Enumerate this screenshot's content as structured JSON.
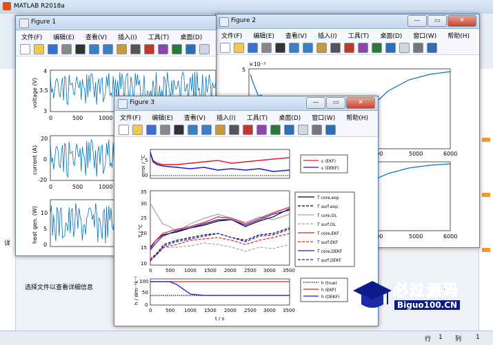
{
  "matlab": {
    "title": "MATLAB R2018a",
    "file_info": "选择文件以查看详细信息",
    "status_row_label": "行",
    "status_row": "1",
    "status_col_label": "列",
    "status_col": "1",
    "side_label": "详"
  },
  "menu": [
    "文件(F)",
    "编辑(E)",
    "查看(V)",
    "插入(I)",
    "工具(T)",
    "桌面(D)",
    "窗口(W)",
    "帮助(H)"
  ],
  "figure1": {
    "title": "Figure 1",
    "ylabels": [
      "voltage (V)",
      "current (A)",
      "heat gen. (W)"
    ],
    "yticks1": [
      "4",
      "3.5",
      "3"
    ],
    "yticks2": [
      "20",
      "0",
      "-20"
    ],
    "yticks3": [
      "10",
      "5",
      "0"
    ],
    "xticks": [
      "0",
      "500",
      "1000"
    ]
  },
  "figure2": {
    "title": "Figure 2",
    "exponent": "×10⁻³",
    "ytick_top": "5",
    "xticks": [
      "4000",
      "5000",
      "6000"
    ]
  },
  "figure3": {
    "title": "Figure 3",
    "xticks": [
      "0",
      "500",
      "1000",
      "1500",
      "2000",
      "2500",
      "3000",
      "3500"
    ],
    "xlabel": "t / s",
    "ylabel1": "error / °C",
    "yticks1": [
      "5",
      "0"
    ],
    "legend1": [
      "ε (EKF)",
      "ε (DEKF)"
    ],
    "ylabel2": "T / °C",
    "yticks2": [
      "35",
      "30",
      "25",
      "20",
      "15",
      "10"
    ],
    "legend2": [
      "T core,exp",
      "T surf,exp",
      "T core,OL",
      "T surf,OL",
      "T core,EKF",
      "T surf,EKF",
      "T core,DEKF",
      "T surf,DEKF"
    ],
    "ylabel3": "h / Wm⁻²k⁻¹",
    "yticks3": [
      "100",
      "50",
      "0"
    ],
    "legend3": [
      "h (true)",
      "h (EKF)",
      "h (DEKF)"
    ]
  },
  "watermark": {
    "text": "必过源码",
    "url": "Biguo100.CN"
  },
  "colors": {
    "blue": "#0072bd",
    "red": "#e8191c",
    "darkblue": "#1414dc",
    "gray": "#a5a5a5"
  }
}
